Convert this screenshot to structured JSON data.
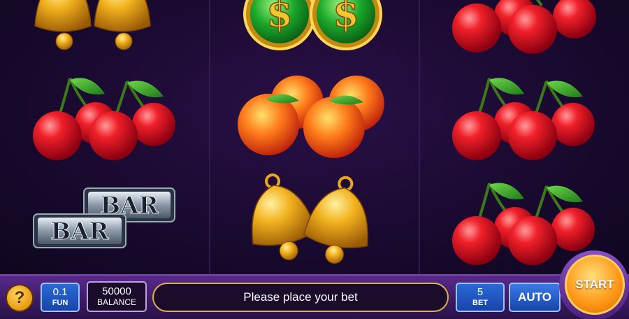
{
  "reels": [
    {
      "id": "reel-1",
      "symbols": [
        "bell-pair",
        "cherry-pair",
        "bar-pair"
      ]
    },
    {
      "id": "reel-2",
      "symbols": [
        "dollar-coin-pair",
        "peach-pair",
        "bell-pair"
      ]
    },
    {
      "id": "reel-3",
      "symbols": [
        "cherry-pair",
        "cherry-pair",
        "cherry-pair"
      ]
    }
  ],
  "bar_symbol": {
    "text": "BAR"
  },
  "coin_symbol": {
    "text": "$"
  },
  "help": {
    "label": "?"
  },
  "denomination": {
    "value": "0.1",
    "label": "FUN"
  },
  "balance": {
    "value": "50000",
    "label": "BALANCE"
  },
  "message": "Please place your bet",
  "bet": {
    "value": "5",
    "label": "BET"
  },
  "auto_button": {
    "label": "AUTO"
  },
  "start_button": {
    "label": "START"
  },
  "colors": {
    "panel": "#3a1a62",
    "accent_gold": "#d9b24a",
    "button_blue": "#1844a8",
    "start_orange": "#ff9a1a"
  }
}
